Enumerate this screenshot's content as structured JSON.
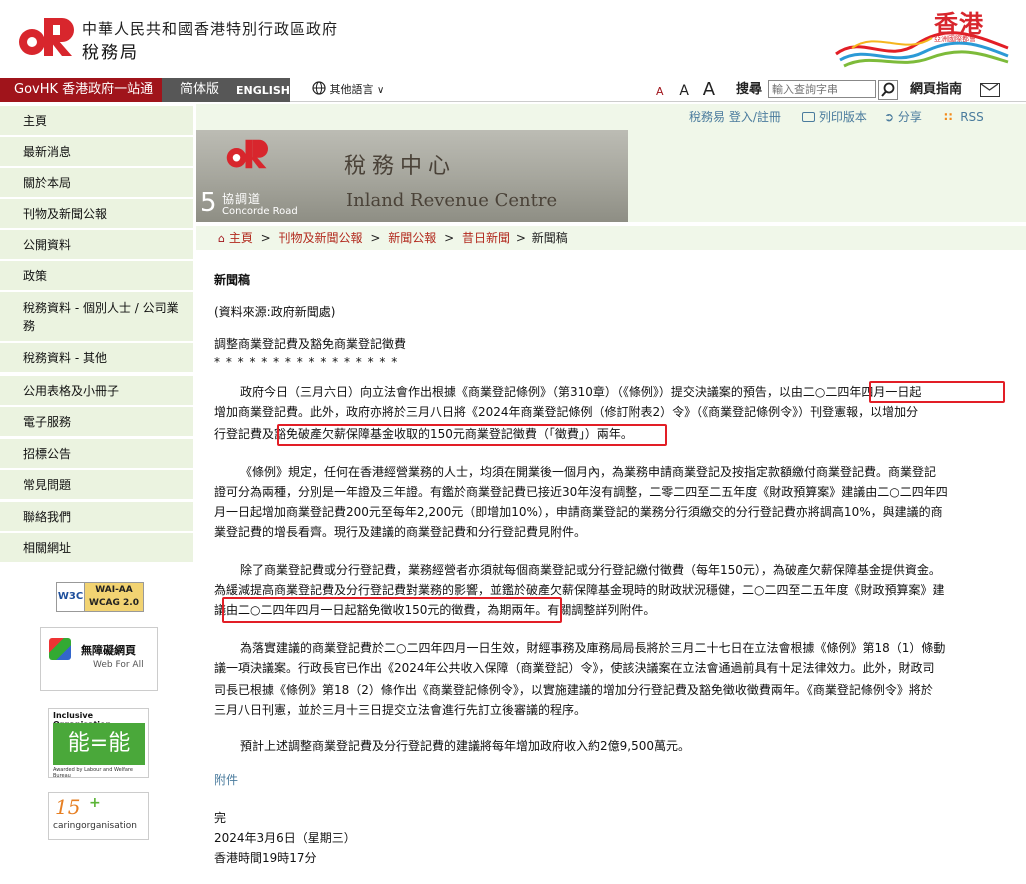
{
  "header": {
    "dept_line1": "中華人民共和國香港特別行政區政府",
    "dept_name": "稅務局",
    "brand_text": "香港",
    "brand_sub": "亞洲國際都會"
  },
  "topbar": {
    "govhk": "GovHK 香港政府一站通",
    "simplified": "简体版",
    "english": "ENGLISH",
    "other_lang": "其他語言",
    "font_small": "A",
    "font_medium": "A",
    "font_large": "A",
    "search_label": "搜尋",
    "search_placeholder": "輸入查詢字串",
    "guide": "網頁指南"
  },
  "sidebar": {
    "items": [
      {
        "label": "主頁"
      },
      {
        "label": "最新消息"
      },
      {
        "label": "關於本局"
      },
      {
        "label": "刊物及新聞公報"
      },
      {
        "label": "公開資料"
      },
      {
        "label": "政策"
      },
      {
        "label": "稅務資料 - 個別人士 / 公司業務"
      },
      {
        "label": "稅務資料 - 其他"
      },
      {
        "label": "公用表格及小冊子"
      },
      {
        "label": "電子服務"
      },
      {
        "label": "招標公告"
      },
      {
        "label": "常見問題"
      },
      {
        "label": "聯絡我們"
      },
      {
        "label": "相關網址"
      }
    ],
    "badges": {
      "wcag": "WAI-AA WCAG 2.0",
      "w3c": "W3C",
      "webforall_cn": "無障礙網頁",
      "webforall_en": "Web For All",
      "inclusive": "Inclusive Organisation",
      "inclusive_sub": "Awarded by Labour and Welfare Bureau",
      "caring_years": "15",
      "caring": "caringorganisation"
    }
  },
  "util": {
    "login": "稅務易 登入/註冊",
    "print": "列印版本",
    "share": "分享",
    "rss": "RSS"
  },
  "banner": {
    "address_num": "5",
    "address_cn": "協調道",
    "address_en": "Concorde Road",
    "centre_cn": "稅務中心",
    "centre_en": "Inland Revenue Centre"
  },
  "breadcrumb": {
    "home": "主頁",
    "sep": ">",
    "pub": "刊物及新聞公報",
    "press": "新聞公報",
    "past": "昔日新聞",
    "current": "新聞稿"
  },
  "article": {
    "heading": "新聞稿",
    "source": "(資料來源:政府新聞處)",
    "title": "調整商業登記費及豁免商業登記徵費",
    "stars": "* * * * * * * * * * * * * * * *",
    "p1_l1": "政府今日（三月六日）向立法會作出根據《商業登記條例》（第310章）（《條例》）提交決議案的預告，以由二○二四年四月一日起",
    "p1_l2": "增加商業登記費。此外，政府亦將於三月八日將《2024年商業登記條例（修訂附表2）令》（《商業登記條例令》）刊登憲報，以增加分",
    "p1_l3": "行登記費及豁免破產欠薪保障基金收取的150元商業登記徵費（「徵費」）兩年。",
    "p2_l1": "《條例》規定，任何在香港經營業務的人士，均須在開業後一個月內，為業務申請商業登記及按指定款額繳付商業登記費。商業登記",
    "p2_l2": "證可分為兩種，分別是一年證及三年證。有鑑於商業登記費已接近30年沒有調整，二零二四至二五年度《財政預算案》建議由二○二四年四",
    "p2_l3": "月一日起增加商業登記費200元至每年2,200元（即增加10%），申請商業登記的業務分行須繳交的分行登記費亦將調高10%，與建議的商",
    "p2_l4": "業登記費的增長看齊。現行及建議的商業登記費和分行登記費見附件。",
    "p3_l1": "除了商業登記費或分行登記費，業務經營者亦須就每個商業登記或分行登記繳付徵費（每年150元），為破產欠薪保障基金提供資金。",
    "p3_l2": "為緩減提高商業登記費及分行登記費對業務的影響，並鑑於破產欠薪保障基金現時的財政狀況穩健，二○二四至二五年度《財政預算案》建",
    "p3_l3": "議由二○二四年四月一日起豁免徵收150元的徵費，為期兩年。有關調整詳列附件。",
    "p4_l1": "為落實建議的商業登記費於二○二四年四月一日生效，財經事務及庫務局局長將於三月二十七日在立法會根據《條例》第18（1）條動",
    "p4_l2": "議一項決議案。行政長官已作出《2024年公共收入保障（商業登記）令》，使該決議案在立法會通過前具有十足法律效力。此外，財政司",
    "p4_l3": "司長已根據《條例》第18（2）條作出《商業登記條例令》，以實施建議的增加分行登記費及豁免徵收徵費兩年。《商業登記條例令》將於",
    "p4_l4": "三月八日刊憲，並於三月十三日提交立法會進行先訂立後審議的程序。",
    "p5": "預計上述調整商業登記費及分行登記費的建議將每年增加政府收入約2億9,500萬元。",
    "attachment": "附件",
    "end": "完",
    "date": "2024年3月6日（星期三）",
    "time": "香港時間19時17分"
  },
  "colors": {
    "brand_red": "#a0141b",
    "nav_bg": "#ebf3e0",
    "link": "#b22a1e",
    "highlight": "#e21e26"
  }
}
